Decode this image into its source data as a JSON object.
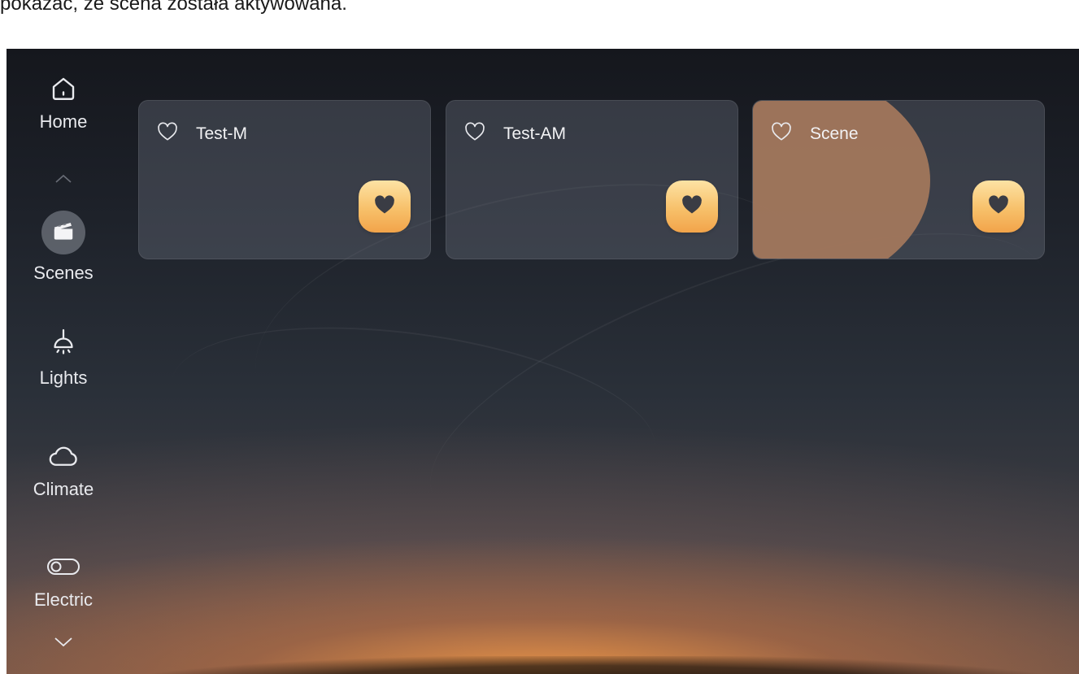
{
  "caption": "pokazać, że scena została aktywowana.",
  "sidebar": {
    "items": [
      {
        "label": "Home",
        "icon": "home-icon"
      },
      {
        "label": "Scenes",
        "icon": "clapperboard-icon",
        "active": true
      },
      {
        "label": "Lights",
        "icon": "ceiling-lamp-icon"
      },
      {
        "label": "Climate",
        "icon": "cloud-icon"
      },
      {
        "label": "Electric",
        "icon": "toggle-switch-icon"
      }
    ],
    "scroll_up_icon": "chevron-up-icon",
    "scroll_down_icon": "chevron-down-icon"
  },
  "scenes": [
    {
      "name": "Test-M",
      "favorite_icon": "heart-outline-icon",
      "run_icon": "heart-filled-icon",
      "activated": false
    },
    {
      "name": "Test-AM",
      "favorite_icon": "heart-outline-icon",
      "run_icon": "heart-filled-icon",
      "activated": false
    },
    {
      "name": "Scene",
      "favorite_icon": "heart-outline-icon",
      "run_icon": "heart-filled-icon",
      "activated": true
    }
  ],
  "colors": {
    "accent_button": "#f7c06a",
    "activation_highlight": "#a5785c",
    "text": "#e9eaee"
  }
}
